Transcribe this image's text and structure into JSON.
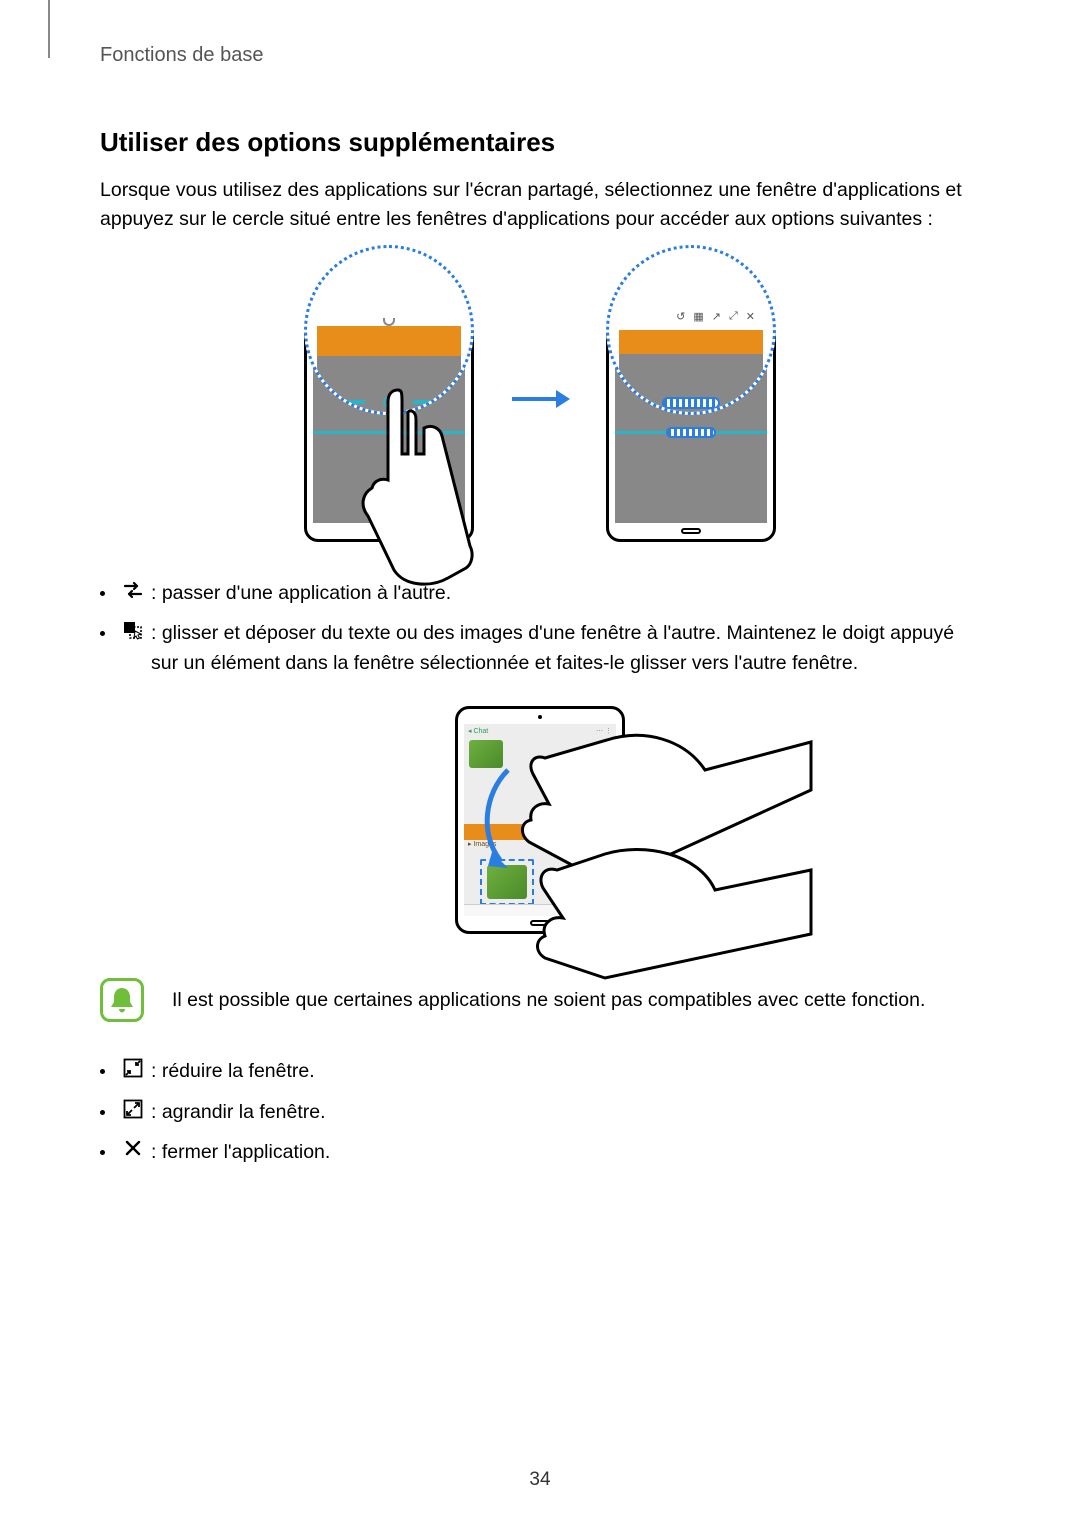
{
  "breadcrumb": "Fonctions de base",
  "section_title": "Utiliser des options supplémentaires",
  "intro": "Lorsque vous utilisez des applications sur l'écran partagé, sélectionnez une fenêtre d'applications et appuyez sur le cercle situé entre les fenêtres d'applications pour accéder aux options suivantes :",
  "list1": {
    "item1": " : passer d'une application à l'autre.",
    "item2": " : glisser et déposer du texte ou des images d'une fenêtre à l'autre. Maintenez le doigt appuyé sur un élément dans la fenêtre sélectionnée et faites-le glisser vers l'autre fenêtre."
  },
  "notice": "Il est possible que certaines applications ne soient pas compatibles avec cette fonction.",
  "list2": {
    "item1": " : réduire la fenêtre.",
    "item2": " : agrandir la fenêtre.",
    "item3": " : fermer l'application."
  },
  "page_number": "34"
}
